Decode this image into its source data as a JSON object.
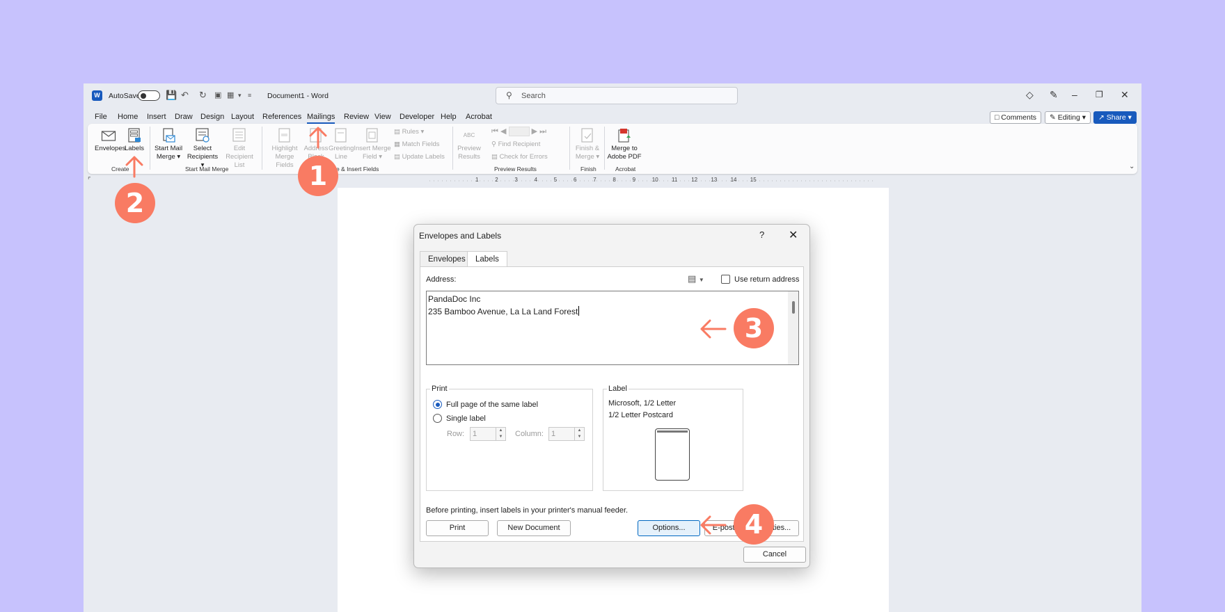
{
  "titlebar": {
    "app_logo": "W",
    "autosave_label": "AutoSave",
    "doc_title": "Document1  -  Word",
    "search_placeholder": "Search"
  },
  "menu": {
    "items": [
      "File",
      "Home",
      "Insert",
      "Draw",
      "Design",
      "Layout",
      "References",
      "Mailings",
      "Review",
      "View",
      "Developer",
      "Help",
      "Acrobat"
    ],
    "active": "Mailings",
    "comments_label": "Comments",
    "editing_label": "Editing",
    "share_label": "Share"
  },
  "ribbon": {
    "envelopes": "Envelopes",
    "labels": "Labels",
    "start_mail_merge": [
      "Start Mail",
      "Merge ▾"
    ],
    "select_recipients": [
      "Select",
      "Recipients ▾"
    ],
    "edit_recipient_list": [
      "Edit",
      "Recipient List"
    ],
    "highlight_merge_fields": [
      "Highlight",
      "Merge Fields"
    ],
    "address_block": [
      "Address",
      "Block"
    ],
    "greeting_line": [
      "Greeting",
      "Line"
    ],
    "insert_merge_field": [
      "Insert Merge",
      "Field ▾"
    ],
    "rules": "Rules ▾",
    "match_fields": "Match Fields",
    "update_labels": "Update Labels",
    "preview_results": [
      "Preview",
      "Results"
    ],
    "preview_abc": "ABC",
    "find_recipient": "Find Recipient",
    "check_for_errors": "Check for Errors",
    "finish_merge": [
      "Finish &",
      "Merge ▾"
    ],
    "merge_to_pdf": [
      "Merge to",
      "Adobe PDF"
    ],
    "groups": {
      "create": "Create",
      "start_mail_merge": "Start Mail Merge",
      "write_insert": "Write & Insert Fields",
      "preview_results": "Preview Results",
      "finish": "Finish",
      "acrobat": "Acrobat"
    }
  },
  "ruler": {
    "numbers": [
      "1",
      "2",
      "3",
      "4",
      "5",
      "6",
      "7",
      "8",
      "9",
      "10",
      "11",
      "12",
      "13",
      "14",
      "15"
    ]
  },
  "dialog": {
    "title": "Envelopes and Labels",
    "help": "?",
    "tabs": {
      "envelopes": "Envelopes",
      "labels": "Labels"
    },
    "active_tab": "Labels",
    "address_label": "Address:",
    "use_return_address": "Use return address",
    "address_lines": [
      "PandaDoc Inc",
      "235 Bamboo Avenue, La La Land Forest"
    ],
    "print": {
      "legend": "Print",
      "full_page": "Full page of the same label",
      "single_label": "Single label",
      "selected": "full_page",
      "row_label": "Row:",
      "row_value": "1",
      "column_label": "Column:",
      "column_value": "1"
    },
    "label": {
      "legend": "Label",
      "line1": "Microsoft, 1/2 Letter",
      "line2": "1/2 Letter Postcard"
    },
    "note": "Before printing, insert labels in your printer's manual feeder.",
    "buttons": {
      "print": "Print",
      "new_document": "New Document",
      "options": "Options...",
      "e_postage": "E-postage Properties...",
      "cancel": "Cancel"
    }
  },
  "callouts": [
    "1",
    "2",
    "3",
    "4"
  ],
  "colors": {
    "background": "#c7c2fd",
    "accent": "#185abd",
    "callout": "#f97b63"
  }
}
